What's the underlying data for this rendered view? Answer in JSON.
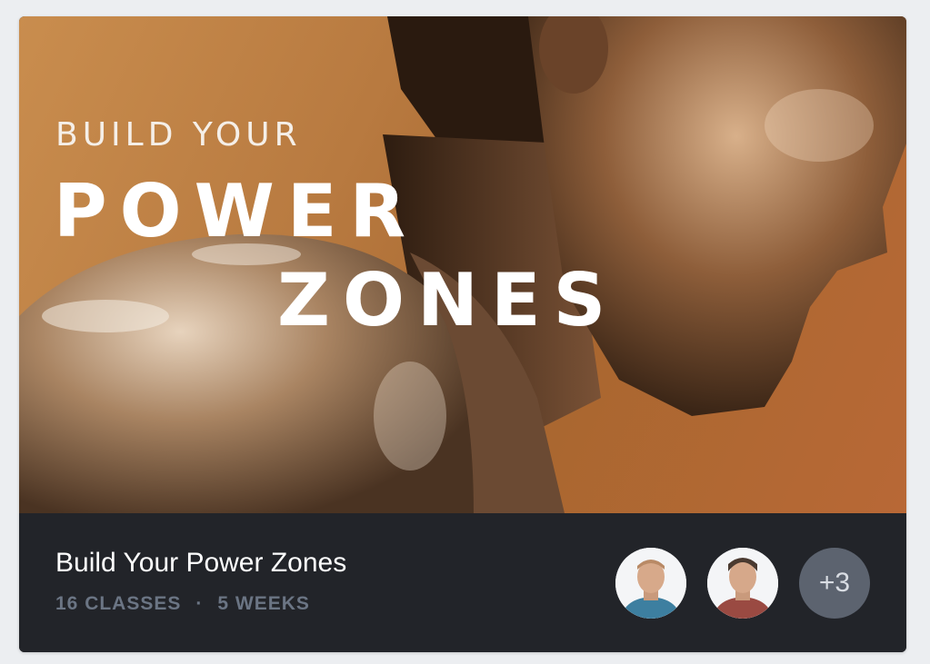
{
  "hero": {
    "kicker": "BUILD YOUR",
    "line1": "POWER",
    "line2": "ZONES"
  },
  "program": {
    "title": "Build Your Power Zones",
    "classes": "16 CLASSES",
    "separator": "·",
    "weeks": "5 WEEKS"
  },
  "instructors": {
    "avatars": [
      "instructor-avatar",
      "instructor-avatar"
    ],
    "more_label": "+3"
  },
  "colors": {
    "card_footer": "#222429",
    "hero_orange": "#b87a40",
    "meta_text": "#6b7584",
    "more_badge": "#5c636f"
  }
}
